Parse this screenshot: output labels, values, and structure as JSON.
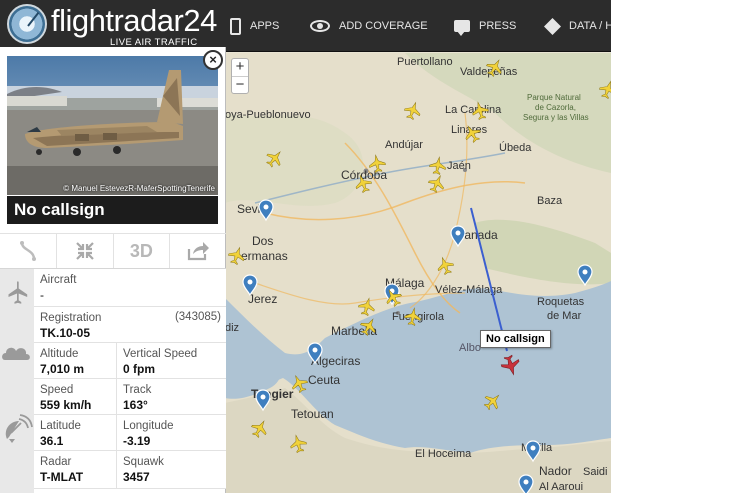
{
  "header": {
    "logo_text": "flightradar",
    "logo_num": "24",
    "logo_subtitle": "LIVE AIR TRAFFIC",
    "nav": [
      {
        "label": "APPS",
        "icon": "phone-icon"
      },
      {
        "label": "ADD COVERAGE",
        "icon": "eye-icon"
      },
      {
        "label": "PRESS",
        "icon": "chat-icon"
      },
      {
        "label": "DATA / H",
        "icon": "box-icon"
      }
    ]
  },
  "panel": {
    "photo_credit": "© Manuel EstevezR-MaferSpottingTenerife",
    "close_symbol": "×",
    "callsign": "No callsign",
    "actions": [
      {
        "name": "route-button",
        "icon": "route-icon",
        "label": ""
      },
      {
        "name": "follow-button",
        "icon": "compress-icon",
        "label": ""
      },
      {
        "name": "3d-view-button",
        "icon": "3d-icon",
        "label": "3D"
      },
      {
        "name": "share-button",
        "icon": "share-icon",
        "label": ""
      }
    ],
    "aircraft": {
      "label": "Aircraft",
      "value": "-"
    },
    "registration": {
      "label": "Registration",
      "value": "TK.10-05",
      "hex": "(343085)"
    },
    "altitude": {
      "label": "Altitude",
      "value": "7,010 m"
    },
    "vertical_speed": {
      "label": "Vertical Speed",
      "value": "0 fpm"
    },
    "speed": {
      "label": "Speed",
      "value": "559 km/h"
    },
    "track": {
      "label": "Track",
      "value": "163°"
    },
    "latitude": {
      "label": "Latitude",
      "value": "36.1"
    },
    "longitude": {
      "label": "Longitude",
      "value": "-3.19"
    },
    "radar": {
      "label": "Radar",
      "value": "T-MLAT"
    },
    "squawk": {
      "label": "Squawk",
      "value": "3457"
    }
  },
  "map": {
    "zoom_in": "+",
    "zoom_out": "−",
    "selected_flight_label": "No callsign",
    "places": [
      "Puertollano",
      "Valdepeñas",
      "La Carolina",
      "Parque Natural",
      "de Cazorla,",
      "Segura y las Villas",
      "oya-Pueblonuevo",
      "Andújar",
      "Linares",
      "Úbeda",
      "Córdoba",
      "Jaén",
      "Baza",
      "Sevi",
      "Dos",
      "ermanas",
      "Granada",
      "Jerez",
      "Málaga",
      "Vélez-Málaga",
      "Roquetas",
      "de Mar",
      "Marbella",
      "Fuengirola",
      "diz",
      "Algeciras",
      "Albo",
      "Ceuta",
      "Tangier",
      "Tetouan",
      "El Hoceima",
      "Melilla",
      "Nador",
      "Saidi",
      "Al Aaroui"
    ]
  },
  "colors": {
    "topbar": "#2c2c2c",
    "callsign_bar": "#1c1c1c",
    "sea": "#aec3d3",
    "land": "#e5dfcb",
    "aircraft": "#f1d23a",
    "selected_aircraft": "#c8323c",
    "flight_path": "#3b5fd0",
    "marker": "#3f7fbf"
  }
}
